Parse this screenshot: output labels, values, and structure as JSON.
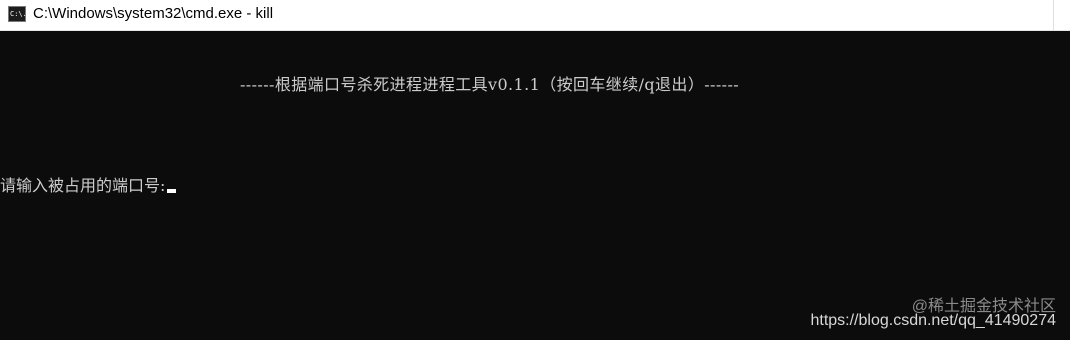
{
  "window": {
    "title": "C:\\Windows\\system32\\cmd.exe - kill",
    "icon": "cmd-icon",
    "icon_text": "C:\\."
  },
  "console": {
    "banner": "------根据端口号杀死进程进程工具v0.1.1（按回车继续/q退出）------",
    "prompt": "请输入被占用的端口号:",
    "input_value": ""
  },
  "watermark": {
    "brand": "@稀土掘金技术社区",
    "url": "https://blog.csdn.net/qq_41490274"
  },
  "colors": {
    "console_bg": "#0c0c0c",
    "console_fg": "#cccccc",
    "titlebar_bg": "#ffffff"
  }
}
